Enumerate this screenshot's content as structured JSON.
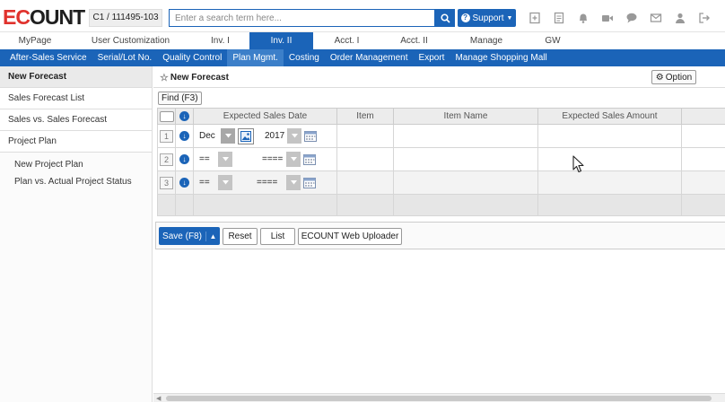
{
  "brand": {
    "logo_red": "EC",
    "logo_dark": "OUNT",
    "company_id": "C1 / 111495-103"
  },
  "search": {
    "placeholder": "Enter a search term here..."
  },
  "support": {
    "label": "Support"
  },
  "header_icons": [
    "new-window-icon",
    "document-icon",
    "bell-icon",
    "video-icon",
    "chat-icon",
    "mail-icon",
    "user-icon",
    "logout-icon"
  ],
  "main_tabs": [
    {
      "label": "MyPage"
    },
    {
      "label": "User Customization"
    },
    {
      "label": "Inv. I"
    },
    {
      "label": "Inv. II",
      "active": true
    },
    {
      "label": "Acct. I"
    },
    {
      "label": "Acct. II"
    },
    {
      "label": "Manage"
    },
    {
      "label": "GW"
    }
  ],
  "sub_menu": [
    {
      "label": "After-Sales Service"
    },
    {
      "label": "Serial/Lot No."
    },
    {
      "label": "Quality Control"
    },
    {
      "label": "Plan Mgmt.",
      "active": true
    },
    {
      "label": "Costing"
    },
    {
      "label": "Order Management"
    },
    {
      "label": "Export"
    },
    {
      "label": "Manage Shopping Mall"
    }
  ],
  "sidebar": {
    "items": [
      {
        "label": "New Forecast"
      },
      {
        "label": "Sales Forecast List"
      },
      {
        "label": "Sales vs. Sales Forecast"
      },
      {
        "label": "Project Plan"
      }
    ],
    "sub_items": [
      {
        "label": "New Project Plan"
      },
      {
        "label": "Plan vs. Actual Project Status"
      }
    ]
  },
  "page": {
    "title": "New Forecast",
    "option_label": "Option",
    "find_label": "Find (F3)"
  },
  "grid": {
    "columns": [
      "Expected Sales Date",
      "Item",
      "Item Name",
      "Expected Sales Amount"
    ],
    "rows": [
      {
        "num": "1",
        "month": "Dec",
        "year": "2017"
      },
      {
        "num": "2",
        "month": "==",
        "year": "===="
      },
      {
        "num": "3",
        "month": "==",
        "year": "===="
      }
    ]
  },
  "actions": {
    "save": "Save (F8)",
    "reset": "Reset",
    "list": "List",
    "uploader": "ECOUNT Web Uploader"
  },
  "colors": {
    "primary": "#1b64b8",
    "logo_red": "#e0322d"
  }
}
